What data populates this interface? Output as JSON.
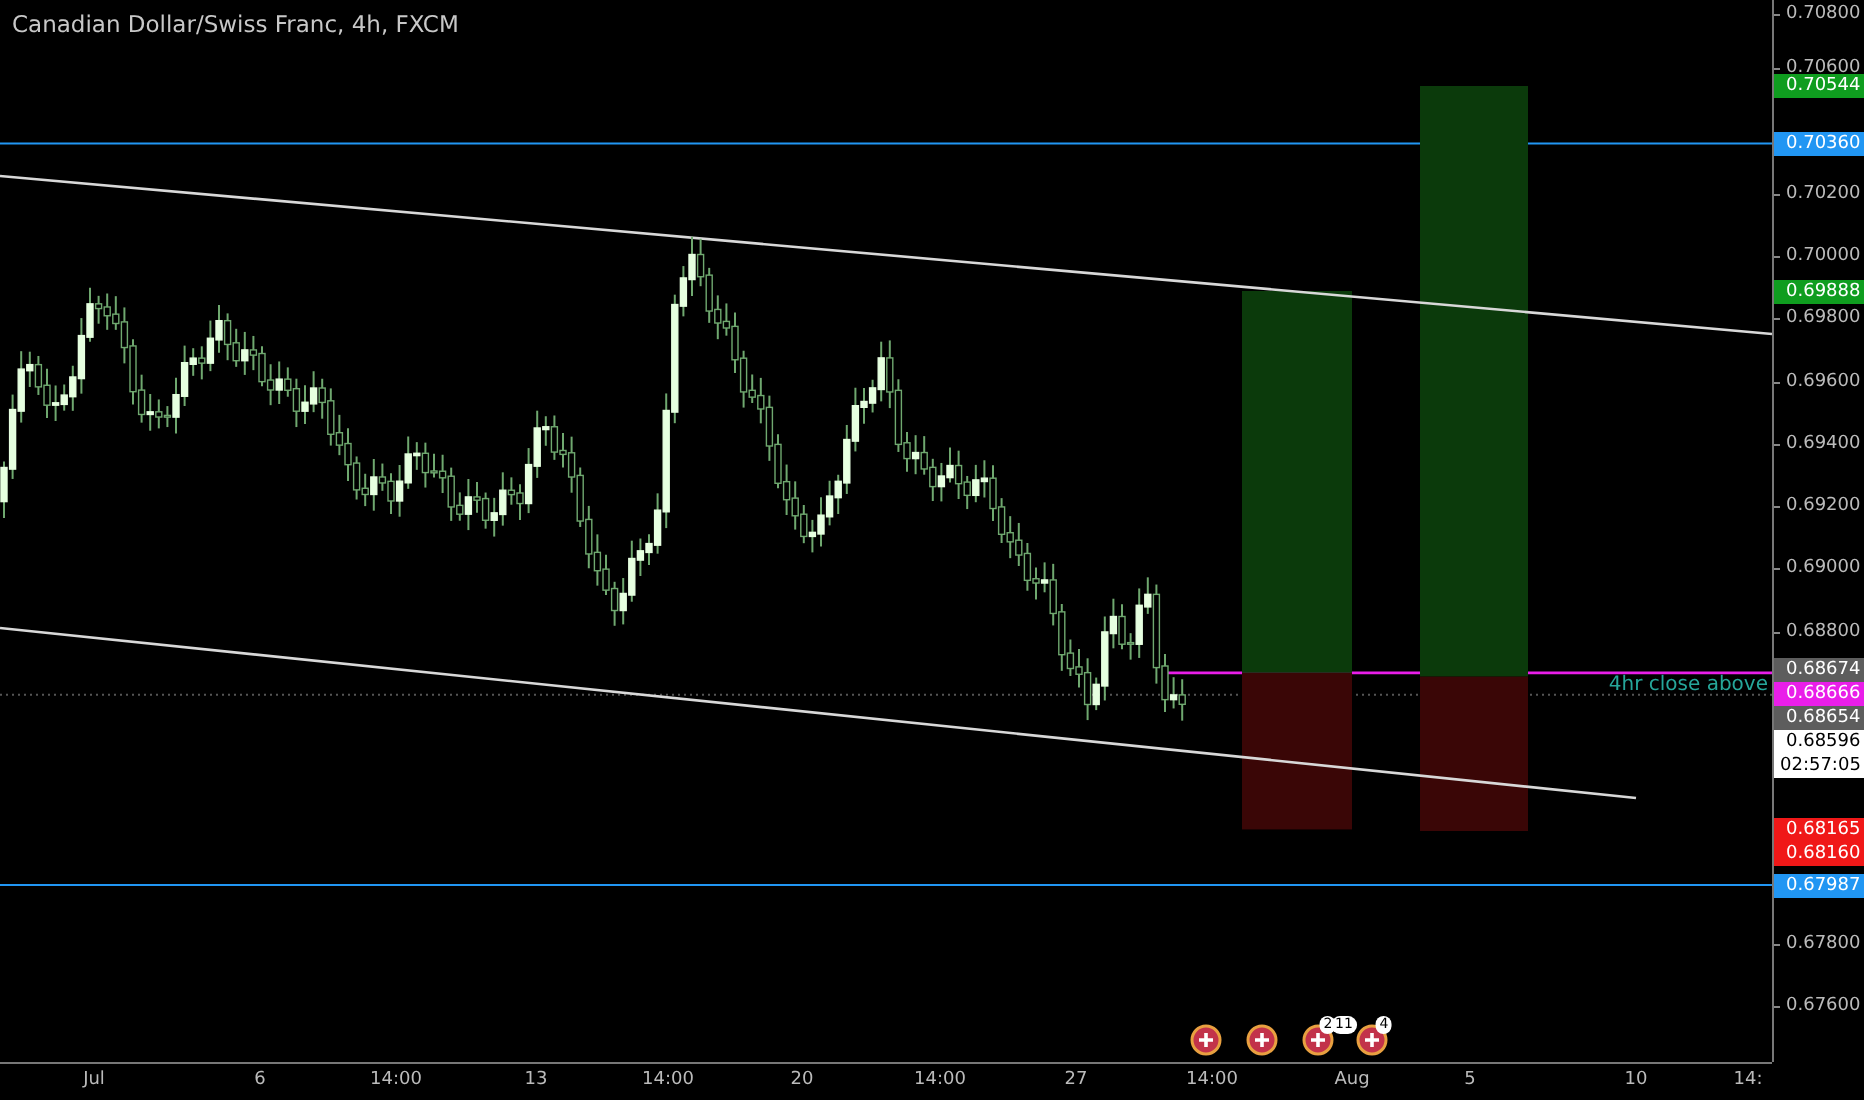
{
  "chart": {
    "title": "Canadian Dollar/Swiss Franc, 4h, FXCM",
    "annotation": "4hr close above",
    "countdown": "02:57:05"
  },
  "price_axis": {
    "ticks": [
      "0.70800",
      "0.70600",
      "0.70200",
      "0.70000",
      "0.69800",
      "0.69600",
      "0.69400",
      "0.69200",
      "0.69000",
      "0.68800",
      "0.67800",
      "0.67600"
    ]
  },
  "price_tags": [
    {
      "price": "0.70544",
      "kind": "target",
      "color": "#0f9d1f"
    },
    {
      "price": "0.70360",
      "kind": "level",
      "color": "#2196f3"
    },
    {
      "price": "0.69888",
      "kind": "target",
      "color": "#0f9d1f"
    },
    {
      "price": "0.68674",
      "kind": "marker",
      "color": "#5d5d5d"
    },
    {
      "price": "0.68666",
      "kind": "alert",
      "color": "#e91ee9"
    },
    {
      "price": "0.68654",
      "kind": "marker",
      "color": "#5d5d5d"
    },
    {
      "price": "0.68596",
      "kind": "last",
      "color": "#ffffff"
    },
    {
      "price": "0.68165",
      "kind": "stop",
      "color": "#f01818"
    },
    {
      "price": "0.68160",
      "kind": "stop",
      "color": "#f01818"
    },
    {
      "price": "0.67987",
      "kind": "level",
      "color": "#2196f3"
    }
  ],
  "time_axis": {
    "ticks": [
      "Jul",
      "6",
      "14:00",
      "13",
      "14:00",
      "20",
      "14:00",
      "27",
      "14:00",
      "Aug",
      "5",
      "10",
      "14:"
    ]
  },
  "events": {
    "badges": [
      "2",
      "11",
      "4"
    ]
  }
}
